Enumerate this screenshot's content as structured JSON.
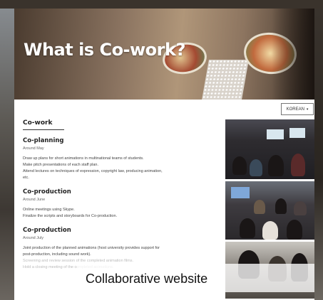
{
  "hero": {
    "title": "What is Co-work?"
  },
  "language": {
    "label": "KOREAN",
    "chevron": "▾"
  },
  "main": {
    "heading": "Co-work",
    "sections": [
      {
        "title": "Co-planning",
        "when": "Around May",
        "lines": [
          "Draw up plans for short animations in multinational teams of students.",
          "Make pitch presentations of each staff plan.",
          "Attend lectures on techniques of expression, copyright law, producing animation,",
          "etc."
        ]
      },
      {
        "title": "Co-production",
        "when": "Around June",
        "lines": [
          "Online meetings using Skype.",
          "Finalize the scripts and storyboards for Co-production."
        ]
      },
      {
        "title": "Co-production",
        "when": "Around July",
        "lines": [
          "Joint production of the planned animations (host university provides support for",
          "post-production, including sound work)."
        ],
        "faded_lines": [
          "Screening and review session of the completed animation films.",
          "Hold a closing meeting of the completed animations."
        ]
      }
    ]
  },
  "caption": "Collaborative website"
}
